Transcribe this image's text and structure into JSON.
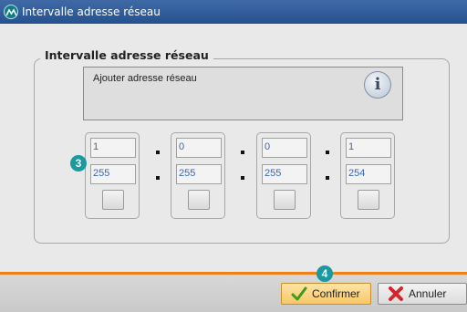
{
  "window": {
    "title": "Intervalle adresse réseau",
    "app_icon": "app-logo-icon"
  },
  "group": {
    "title": "Intervalle adresse réseau",
    "info_text": "Ajouter adresse réseau",
    "info_icon": "info-icon"
  },
  "octets": [
    {
      "start": "1",
      "end": "255"
    },
    {
      "start": "0",
      "end": "255"
    },
    {
      "start": "0",
      "end": "255"
    },
    {
      "start": "1",
      "end": "254"
    }
  ],
  "separator": ".",
  "badges": {
    "address_range": "3",
    "confirm": "4"
  },
  "buttons": {
    "confirm_label": "Confirmer",
    "confirm_icon": "check-icon",
    "cancel_label": "Annuler",
    "cancel_icon": "x-icon"
  },
  "colors": {
    "accent_orange": "#ef7f1a",
    "badge_teal": "#1a9aa0",
    "title_blue": "#25518f"
  }
}
